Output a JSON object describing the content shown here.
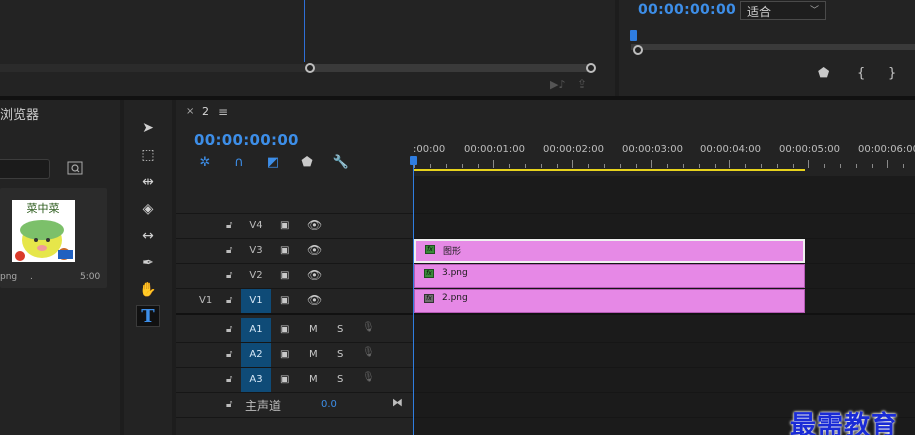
{
  "source_monitor": {},
  "program_monitor": {
    "timecode": "00:00:00:00",
    "fit_select": "适合"
  },
  "project_browser": {
    "title": "浏览器",
    "item": {
      "filename": "png",
      "dot": ".",
      "duration": "5:00",
      "thumb_text": "菜中菜"
    }
  },
  "timeline": {
    "tab_close": "×",
    "tab_name": "2",
    "menu_icon": "≡",
    "timecode": "00:00:00:00",
    "ruler": [
      ":00:00",
      "00:00:01:00",
      "00:00:02:00",
      "00:00:03:00",
      "00:00:04:00",
      "00:00:05:00",
      "00:00:06:00"
    ],
    "video_tracks": [
      {
        "name": "V4",
        "source": "",
        "active": false
      },
      {
        "name": "V3",
        "source": "",
        "active": true
      },
      {
        "name": "V2",
        "source": "",
        "active": true
      },
      {
        "name": "V1",
        "source": "V1",
        "active": true
      }
    ],
    "audio_tracks": [
      {
        "name": "A1",
        "m": "M",
        "s": "S"
      },
      {
        "name": "A2",
        "m": "M",
        "s": "S"
      },
      {
        "name": "A3",
        "m": "M",
        "s": "S"
      }
    ],
    "clips": [
      {
        "label": "图形",
        "track": "V3"
      },
      {
        "label": "3.png",
        "track": "V2"
      },
      {
        "label": "2.png",
        "track": "V1"
      }
    ],
    "master": {
      "label": "主声道",
      "value": "0.0"
    }
  },
  "watermark": "最需教育",
  "colors": {
    "accent": "#3d8ee8",
    "clip": "#e688e6",
    "work_area": "#e7d21c",
    "track_active": "#0f4b77"
  }
}
